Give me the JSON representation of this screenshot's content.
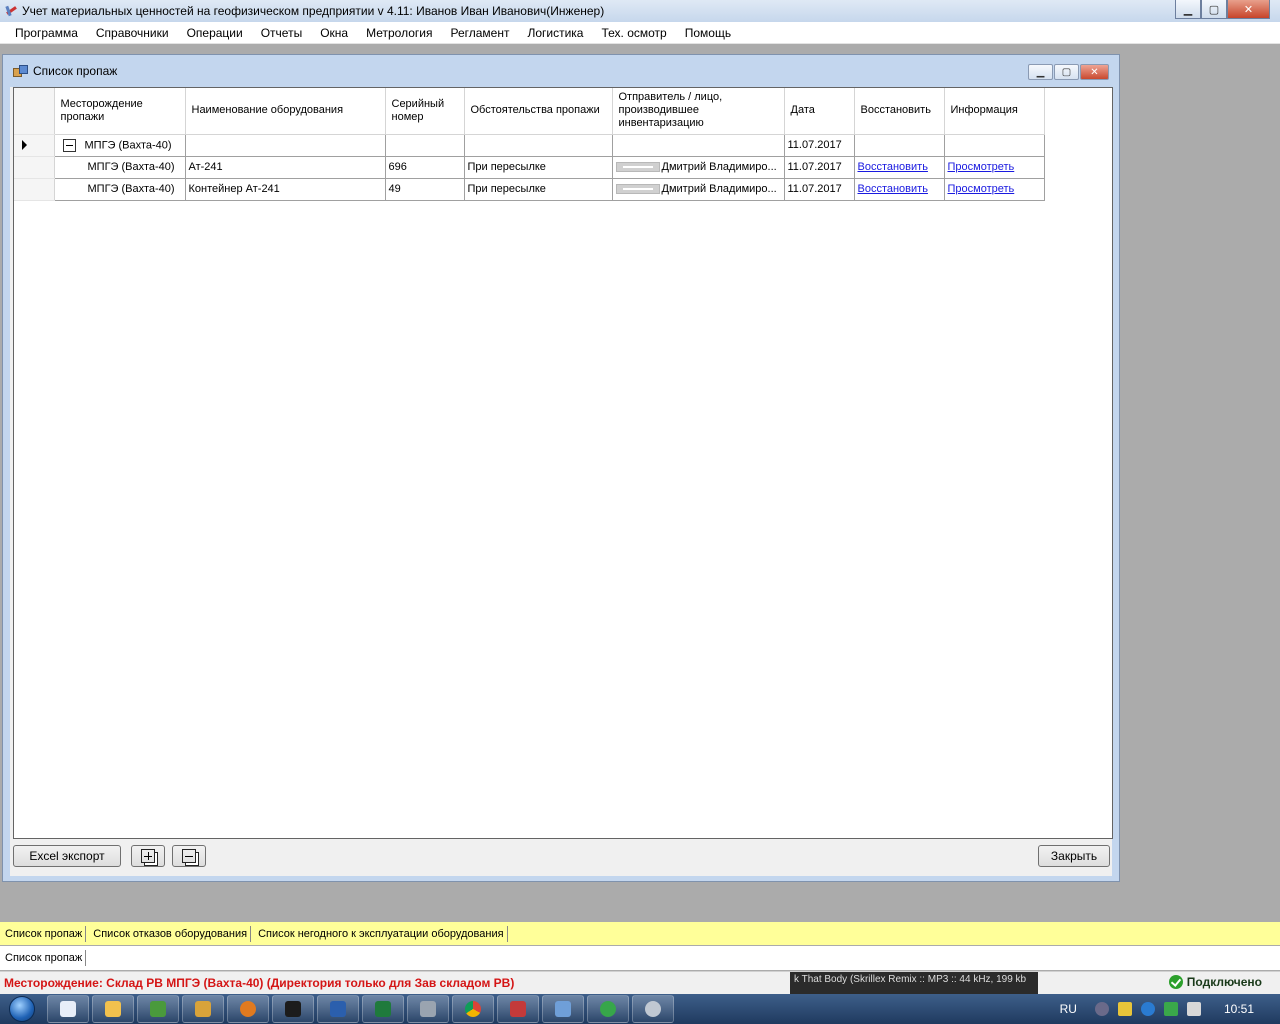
{
  "app": {
    "title": "Учет материальных ценностей на геофизическом предприятии v 4.11: Иванов Иван Иванович(Инженер)",
    "min_glyph": "▁",
    "max_glyph": "▢",
    "close_glyph": "✕"
  },
  "menu": [
    "Программа",
    "Справочники",
    "Операции",
    "Отчеты",
    "Окна",
    "Метрология",
    "Регламент",
    "Логистика",
    "Тех. осмотр",
    "Помощь"
  ],
  "child": {
    "title": "Список пропаж",
    "min_glyph": "▁",
    "max_glyph": "▢",
    "close_glyph": "✕"
  },
  "grid": {
    "columns": [
      "Месторождение пропажи",
      "Наименование оборудования",
      "Серийный номер",
      "Обстоятельства пропажи",
      "Отправитель / лицо, производившее инвентаризацию",
      "Дата",
      "Восстановить",
      "Информация"
    ],
    "group_row": {
      "field": "МПГЭ (Вахта-40)",
      "date": "11.07.2017"
    },
    "rows": [
      {
        "field": "МПГЭ (Вахта-40)",
        "name": "Ат-241",
        "serial": "696",
        "circumstance": "При пересылке",
        "sender": "Дмитрий Владимиро...",
        "date": "11.07.2017",
        "restore": "Восстановить",
        "info": "Просмотреть"
      },
      {
        "field": "МПГЭ (Вахта-40)",
        "name": "Контейнер Ат-241",
        "serial": "49",
        "circumstance": "При пересылке",
        "sender": "Дмитрий Владимиро...",
        "date": "11.07.2017",
        "restore": "Восстановить",
        "info": "Просмотреть"
      }
    ]
  },
  "buttons": {
    "excel": "Excel экспорт",
    "close": "Закрыть"
  },
  "tabs_primary": [
    "Список пропаж",
    "Список отказов оборудования",
    "Список негодного к эксплуатации оборудования"
  ],
  "tabs_secondary": [
    "Список пропаж"
  ],
  "status": {
    "field_info": "Месторождение: Склад РВ МПГЭ (Вахта-40) (Директория только для Зав складом РВ)",
    "connection": "Подключено",
    "media": "k That Body (Skrillex Remix :: MP3 :: 44 kHz, 199 kb"
  },
  "taskbar": {
    "lang": "RU",
    "clock": "10:51"
  },
  "colors": {
    "tab_bar_primary": "#ffff99",
    "status_text": "#d41515",
    "link": "#1a1ae0"
  }
}
